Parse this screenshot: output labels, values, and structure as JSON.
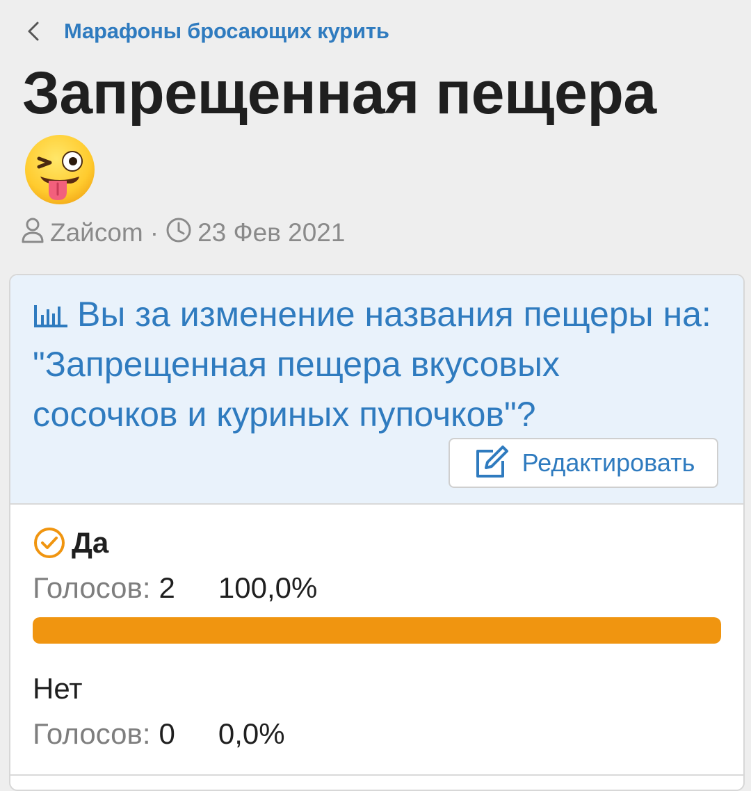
{
  "breadcrumb": {
    "back_icon": "chevron-left-icon",
    "link_label": "Марафоны бросающих курить"
  },
  "thread": {
    "title": "Запрещенная пещера",
    "emoji": "winking-face-with-tongue-emoji",
    "author": "Zайсom",
    "date": "23 Фев 2021"
  },
  "poll": {
    "question": "Вы за изменение названия пещеры на: \"Запрещенная пещера вкусовых сосочков и куриных пупочков\"?",
    "edit_label": "Редактировать",
    "accent_color": "#2f7bbf",
    "bar_color": "#f09510",
    "options": [
      {
        "label": "Да",
        "votes_label": "Голосов:",
        "votes": "2",
        "percent": "100,0%",
        "fraction": 1.0,
        "selected": true
      },
      {
        "label": "Нет",
        "votes_label": "Голосов:",
        "votes": "0",
        "percent": "0,0%",
        "fraction": 0.0,
        "selected": false
      }
    ]
  }
}
